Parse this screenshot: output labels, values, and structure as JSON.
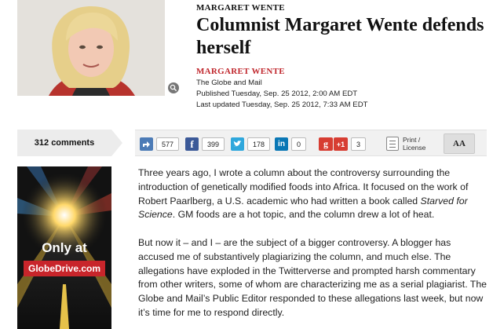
{
  "header": {
    "kicker": "MARGARET WENTE",
    "headline": "Columnist Margaret Wente defends herself",
    "byline": "MARGARET WENTE",
    "publication": "The Globe and Mail",
    "published": "Published Tuesday, Sep. 25 2012, 2:00 AM EDT",
    "updated": "Last updated Tuesday, Sep. 25 2012, 7:33 AM EDT"
  },
  "comments": {
    "label": "312 comments"
  },
  "share": {
    "items": [
      {
        "icon": "share-icon",
        "count": "577",
        "color": "#4c7bb6"
      },
      {
        "icon": "facebook-icon",
        "count": "399",
        "color": "#3b5998"
      },
      {
        "icon": "twitter-icon",
        "count": "178",
        "color": "#2fa7dc"
      },
      {
        "icon": "linkedin-icon",
        "count": "0",
        "color": "#0a77b5"
      },
      {
        "icon": "google-plus-icon",
        "count": "3",
        "color": "#d73d32",
        "label": "+1"
      }
    ],
    "print_label_1": "Print /",
    "print_label_2": "License",
    "text_size_label": "AA"
  },
  "ad": {
    "line1": "Only at",
    "line2": "GlobeDrive.com"
  },
  "article": {
    "p1_a": "Three years ago, I wrote a column about the controversy surrounding the introduction of genetically modified foods into Africa. It focused on the work of Robert Paarlberg, a U.S. academic who had written a book called ",
    "p1_book": "Starved for Science",
    "p1_b": ". GM foods are a hot topic, and the column drew a lot of heat.",
    "p2": "But now it – and I – are the subject of a bigger controversy. A blogger has accused me of substantively plagiarizing the column, and much else. The allegations have exploded in the Twitterverse and prompted harsh commentary from other writers, some of whom are characterizing me as a serial plagiarist. The Globe and Mail’s Public Editor responded to these allegations last week, but now it’s time for me to respond directly."
  }
}
